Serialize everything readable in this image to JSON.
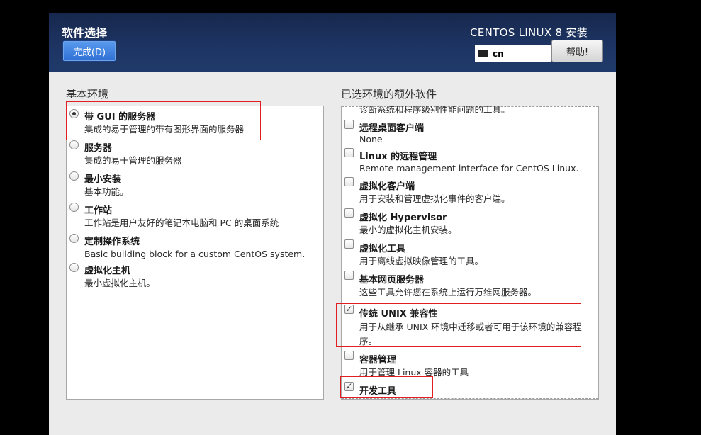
{
  "header": {
    "page_title": "软件选择",
    "done_label": "完成(D)",
    "product_title": "CENTOS LINUX 8 安装",
    "keyboard_layout": "cn",
    "help_label": "帮助!"
  },
  "base_env": {
    "label": "基本环境",
    "items": [
      {
        "title": "带 GUI 的服务器",
        "desc": "集成的易于管理的带有图形界面的服务器",
        "selected": true
      },
      {
        "title": "服务器",
        "desc": "集成的易于管理的服务器",
        "selected": false
      },
      {
        "title": "最小安装",
        "desc": "基本功能。",
        "selected": false
      },
      {
        "title": "工作站",
        "desc": "工作站是用户友好的笔记本电脑和 PC 的桌面系统",
        "selected": false
      },
      {
        "title": "定制操作系统",
        "desc": "Basic building block for a custom CentOS system.",
        "selected": false
      },
      {
        "title": "虚拟化主机",
        "desc": "最小虚拟化主机。",
        "selected": false
      }
    ]
  },
  "addons": {
    "label": "已选环境的额外软件",
    "partial_top_desc": "诊断系统和程序级别性能问题的工具。",
    "items": [
      {
        "title": "远程桌面客户端",
        "desc": "None",
        "checked": false
      },
      {
        "title": "Linux 的远程管理",
        "desc": "Remote management interface for CentOS Linux.",
        "checked": false
      },
      {
        "title": "虚拟化客户端",
        "desc": "用于安装和管理虚拟化事件的客户端。",
        "checked": false
      },
      {
        "title": "虚拟化 Hypervisor",
        "desc": "最小的虚拟化主机安装。",
        "checked": false
      },
      {
        "title": "虚拟化工具",
        "desc": "用于离线虚拟映像管理的工具。",
        "checked": false
      },
      {
        "title": "基本网页服务器",
        "desc": "这些工具允许您在系统上运行万维网服务器。",
        "checked": false
      },
      {
        "title": "传统 UNIX 兼容性",
        "desc": "用于从继承 UNIX 环境中迁移或者可用于该环境的兼容程序。",
        "checked": true
      },
      {
        "title": "容器管理",
        "desc": "用于管理 Linux 容器的工具",
        "checked": false
      },
      {
        "title": "开发工具",
        "desc": "",
        "checked": true
      }
    ]
  },
  "colors": {
    "header_bg": "#1e3564",
    "accent_button": "#3f7fe0",
    "annotation_red": "#e02020"
  }
}
